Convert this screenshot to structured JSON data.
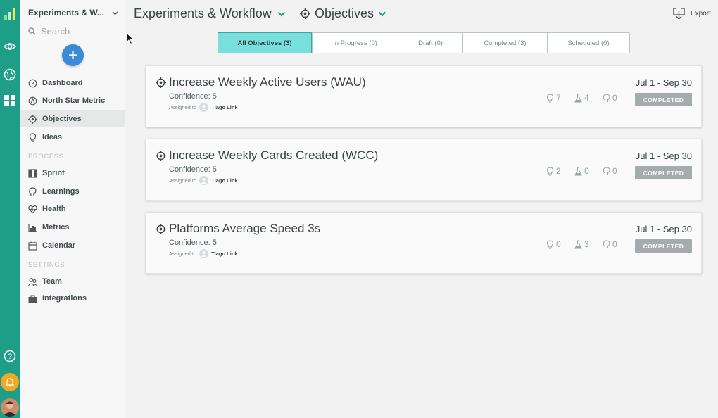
{
  "sidebar": {
    "workspace": "Experiments & W...",
    "search_placeholder": "Search",
    "items": [
      {
        "label": "Dashboard"
      },
      {
        "label": "North Star Metric"
      },
      {
        "label": "Objectives"
      },
      {
        "label": "Ideas"
      }
    ],
    "process_header": "PROCESS",
    "process_items": [
      {
        "label": "Sprint"
      },
      {
        "label": "Learnings"
      },
      {
        "label": "Health"
      },
      {
        "label": "Metrics"
      },
      {
        "label": "Calendar"
      }
    ],
    "settings_header": "SETTINGS",
    "settings_items": [
      {
        "label": "Team"
      },
      {
        "label": "Integrations"
      }
    ]
  },
  "header": {
    "project": "Experiments & Workflow",
    "section": "Objectives",
    "export_label": "Export"
  },
  "tabs": [
    {
      "label": "All Objectives (3)"
    },
    {
      "label": "In Progress (0)"
    },
    {
      "label": "Draft (0)"
    },
    {
      "label": "Completed (3)"
    },
    {
      "label": "Scheduled (0)"
    }
  ],
  "objectives": [
    {
      "title": "Increase Weekly Active Users (WAU)",
      "confidence": "Confidence: 5",
      "assigned_label": "Assigned to",
      "assignee": "Tiago Link",
      "date": "Jul 1 - Sep 30",
      "ideas": "7",
      "experiments": "4",
      "learnings": "0",
      "status": "COMPLETED"
    },
    {
      "title": "Increase Weekly Cards Created (WCC)",
      "confidence": "Confidence: 5",
      "assigned_label": "Assigned to",
      "assignee": "Tiago Link",
      "date": "Jul 1 - Sep 30",
      "ideas": "2",
      "experiments": "0",
      "learnings": "0",
      "status": "COMPLETED"
    },
    {
      "title": "Platforms Average Speed 3s",
      "confidence": "Confidence: 5",
      "assigned_label": "Assigned to",
      "assignee": "Tiago Link",
      "date": "Jul 1 - Sep 30",
      "ideas": "0",
      "experiments": "3",
      "learnings": "0",
      "status": "COMPLETED"
    }
  ],
  "colors": {
    "rail": "#1e9e86",
    "accent": "#79dfdc",
    "add_button": "#3c8ad6",
    "badge": "#a4acad",
    "notification": "#f5a623"
  }
}
